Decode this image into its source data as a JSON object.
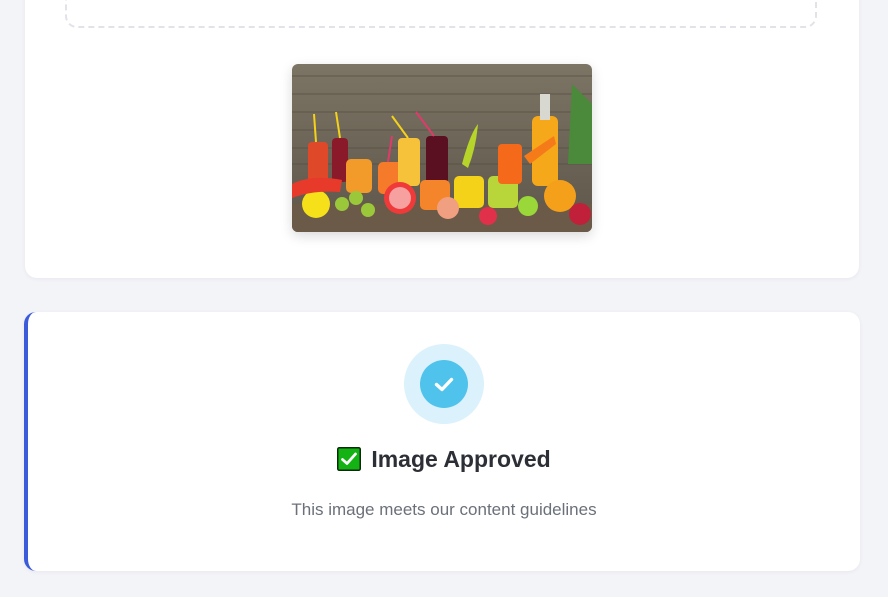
{
  "upload": {
    "preview_alt": "Preview of uploaded image"
  },
  "result": {
    "status": "approved",
    "title": "Image Approved",
    "subtitle": "This image meets our content guidelines",
    "icons": {
      "status": "check-circle-icon",
      "title": "green-check-box-icon"
    },
    "colors": {
      "accent_border": "#3b5bdb",
      "status_ring": "#dbf1fb",
      "status_dot": "#4fc3ec",
      "title_check": "#12b312"
    }
  }
}
